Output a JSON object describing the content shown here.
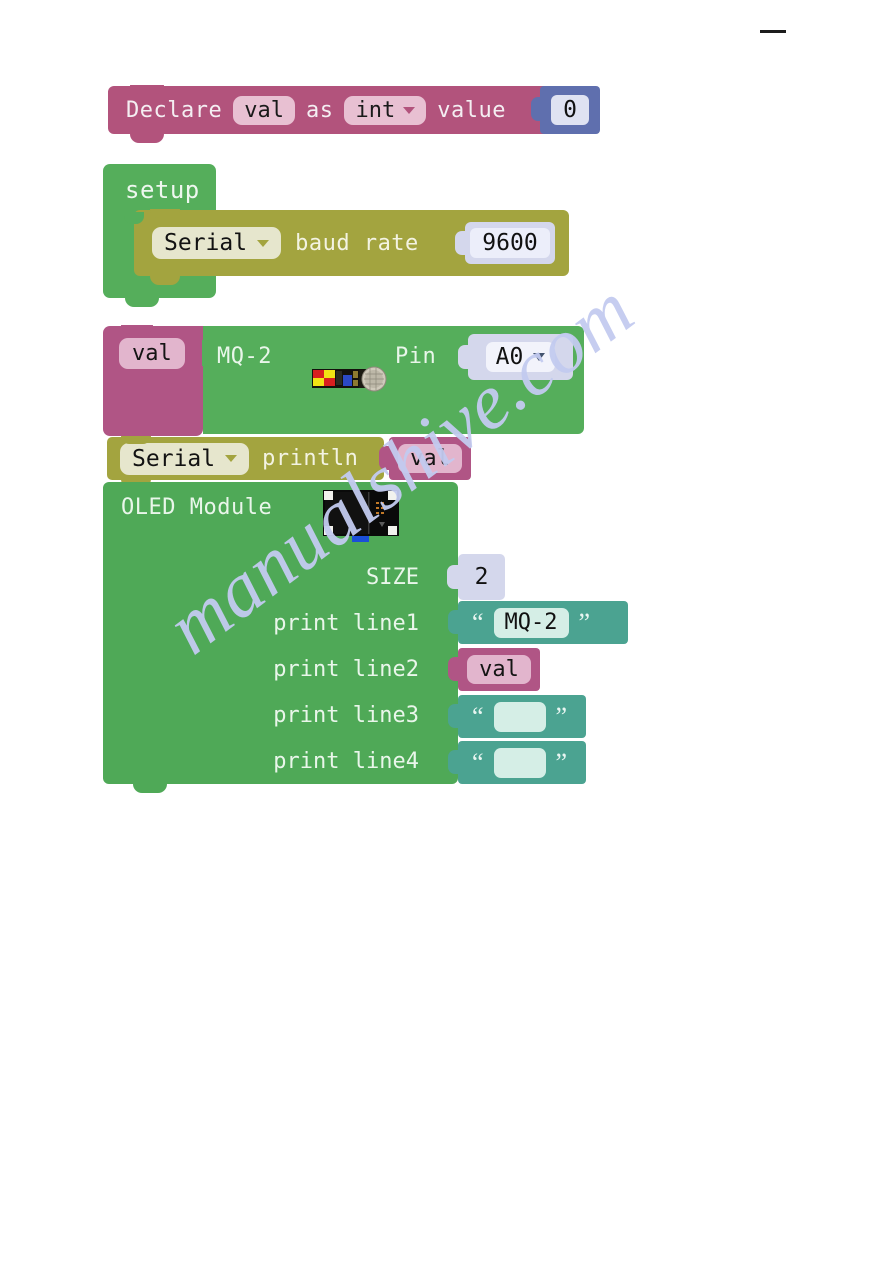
{
  "page": {
    "watermark": "manualshive.com",
    "background": "#ffffff"
  },
  "colors": {
    "declare_block": "#b2537c",
    "declare_field": "#e8c0d2",
    "number_socket": "#5f6fae",
    "number_field": "#dfe2f2",
    "green_block": "#55ae5b",
    "olive_block": "#a3a43f",
    "olive_field": "#e6e6cd",
    "variable_block": "#b05585",
    "variable_field": "#e2b5cd",
    "string_block": "#4ba391",
    "string_field": "#d5eee6",
    "socket_light": "#d4d7ec"
  },
  "blocks": {
    "declare": {
      "name": "declare-variable-block",
      "prefix": "Declare",
      "variable": "val",
      "as": "as",
      "type": "int",
      "suffix": "value",
      "value": "0"
    },
    "setup": {
      "name": "setup-block",
      "label": "setup",
      "serial_baud": {
        "port": "Serial",
        "text": "baud rate",
        "value": "9600"
      }
    },
    "mq2_read": {
      "assign_variable": "val",
      "label": "MQ-2",
      "pin_label": "Pin",
      "pin_value": "A0",
      "sensor_image": "mq2-gas-sensor-module-image"
    },
    "serial_println": {
      "port": "Serial",
      "method": "println",
      "argument": "val"
    },
    "oled": {
      "label": "OLED Module",
      "module_image": "oled-display-module-image",
      "rows": [
        {
          "label": "SIZE",
          "kind": "number",
          "value": "2"
        },
        {
          "label": "print line1",
          "kind": "string",
          "value": "MQ-2"
        },
        {
          "label": "print line2",
          "kind": "variable",
          "value": "val"
        },
        {
          "label": "print line3",
          "kind": "string",
          "value": ""
        },
        {
          "label": "print line4",
          "kind": "string",
          "value": ""
        }
      ]
    }
  }
}
